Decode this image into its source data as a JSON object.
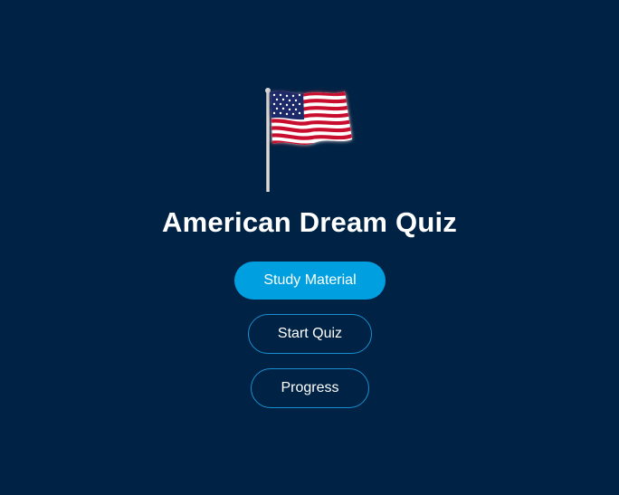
{
  "app": {
    "title": "American Dream Quiz",
    "logo_icon": "american-flag-icon"
  },
  "menu": {
    "study_label": "Study Material",
    "start_label": "Start Quiz",
    "progress_label": "Progress"
  },
  "colors": {
    "background": "#002244",
    "primary_button": "#00a0e0",
    "outline_border": "#1a8fd0",
    "text": "#ffffff"
  }
}
